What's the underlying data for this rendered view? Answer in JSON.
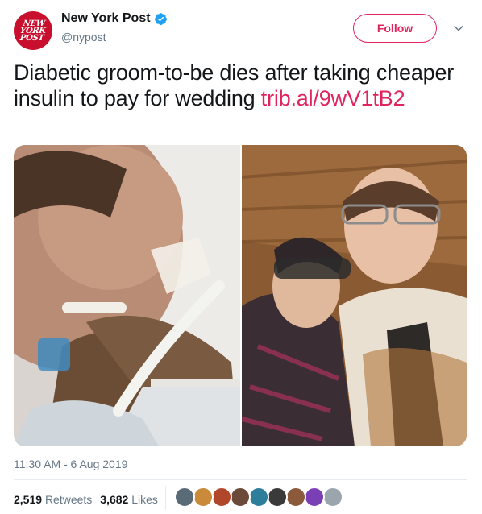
{
  "account": {
    "display_name": "New York Post",
    "handle": "@nypost",
    "logo_text": "NEW YORK POST",
    "verified": true,
    "avatar_color": "#c8102e"
  },
  "follow_button": {
    "label": "Follow",
    "accent": "#e0245e"
  },
  "tweet": {
    "text": "Diabetic groom-to-be dies after taking cheaper insulin to pay for wedding ",
    "link": "trib.al/9wV1tB2",
    "link_color": "#e0245e"
  },
  "media": {
    "count": 2,
    "items": [
      {
        "subject": "man-in-hospital-bed-with-breathing-tube"
      },
      {
        "subject": "couple-selfie"
      }
    ]
  },
  "timestamp": "11:30 AM - 6 Aug 2019",
  "stats": {
    "retweets_count": "2,519",
    "retweets_label": "Retweets",
    "likes_count": "3,682",
    "likes_label": "Likes",
    "liker_colors": [
      "#5a6b78",
      "#c98a3a",
      "#b0462a",
      "#6b4a3a",
      "#2e7d9a",
      "#3a3a3a",
      "#8a5a3a",
      "#7b3fb5",
      "#9aa5ad"
    ]
  },
  "icons": {
    "verified": "verified-badge-icon",
    "chevron": "chevron-down-icon"
  }
}
